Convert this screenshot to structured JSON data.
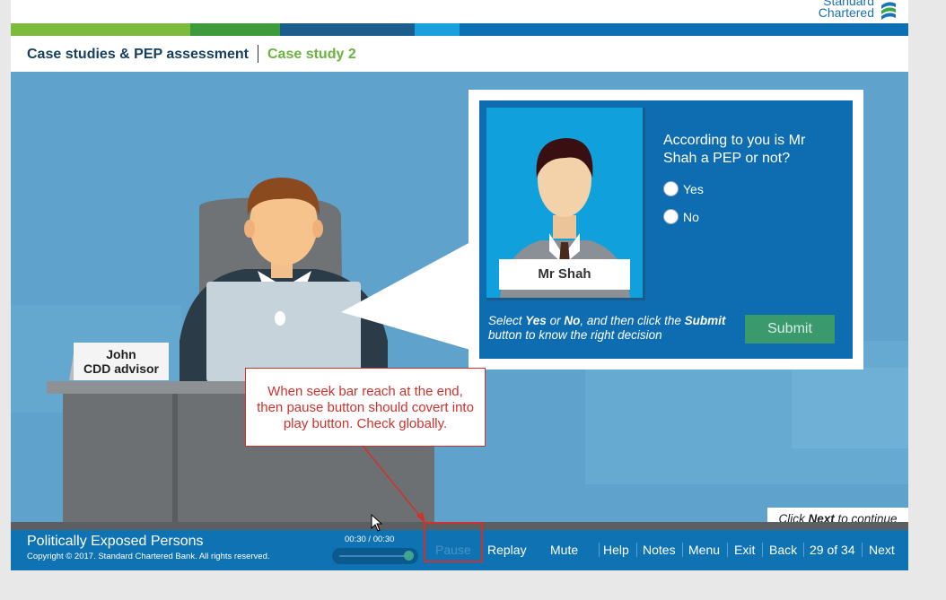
{
  "brand": {
    "line1": "Standard",
    "line2": "Chartered"
  },
  "header": {
    "course_title": "Case studies & PEP assessment",
    "section_title": "Case study 2",
    "strip_colors": [
      "#7dbb3f",
      "#3d9b3c",
      "#1b5e8e",
      "#0f4e80",
      "#1aa0dc",
      "#0d70b3"
    ]
  },
  "scene": {
    "advisor_nameplate": {
      "name": "John",
      "role": "CDD advisor"
    }
  },
  "question_panel": {
    "person_name": "Mr Shah",
    "question": "According to you is Mr Shah a PEP or not?",
    "options": [
      "Yes",
      "No"
    ],
    "instruction_parts": [
      "Select ",
      "Yes",
      " or ",
      "No",
      ", and then click the ",
      "Submit",
      " button to know the right decision"
    ],
    "submit_label": "Submit"
  },
  "annotation": {
    "text": "When seek bar reach at the end, then pause button should covert into play button. Check globally.",
    "color": "#d0312d"
  },
  "click_next": {
    "prefix": "Click ",
    "bold": "Next",
    "suffix": " to continue"
  },
  "footer": {
    "course_name": "Politically Exposed Persons",
    "copyright": "Copyright © 2017. Standard Chartered Bank. All rights reserved.",
    "timer": "00:30 / 00:30",
    "seek_progress": 1.0,
    "controls": {
      "pause": "Pause",
      "replay": "Replay",
      "mute": "Mute",
      "help": "Help",
      "notes": "Notes",
      "menu": "Menu",
      "exit": "Exit",
      "back": "Back",
      "page": "29 of 34",
      "next": "Next"
    }
  }
}
